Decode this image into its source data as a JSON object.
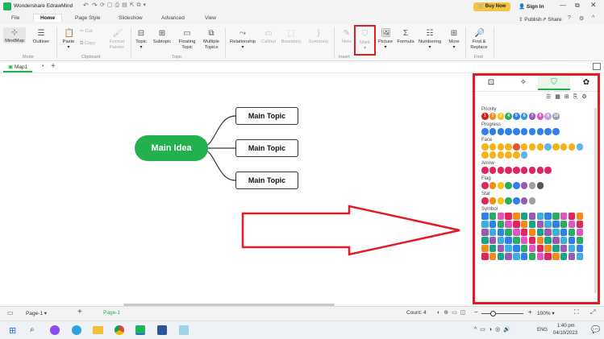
{
  "app": {
    "title": "Wondershare EdrawMind",
    "buy_now": "Buy Now",
    "sign_in": "Sign In",
    "publish": "Publish",
    "share": "Share"
  },
  "menu": {
    "tabs": [
      "File",
      "Home",
      "Page Style",
      "Slideshow",
      "Advanced",
      "View"
    ]
  },
  "ribbon": {
    "buttons": {
      "mindmap": "MindMap",
      "outliner": "Outliner",
      "paste": "Paste",
      "cut": "Cut",
      "copy": "Copy",
      "format_painter": "Format\nPainter",
      "topic": "Topic",
      "subtopic": "Subtopic",
      "floating_topic": "Floating\nTopic",
      "multiple_topics": "Multiple\nTopics",
      "relationship": "Relationship",
      "callout": "Callout",
      "boundary": "Boundary",
      "summary": "Summary",
      "note": "Note",
      "mark": "Mark",
      "picture": "Picture",
      "formula": "Formula",
      "numbering": "Numbering",
      "more": "More",
      "find_replace": "Find &\nReplace"
    },
    "groups": {
      "mode": "Mode",
      "clipboard": "Clipboard",
      "topic": "Topic",
      "insert": "Insert",
      "find": "Find"
    }
  },
  "doc_tab": {
    "label": "Map1"
  },
  "mindmap": {
    "main_idea": "Main Idea",
    "topics": [
      "Main Topic",
      "Main Topic",
      "Main Topic"
    ],
    "main_color": "#22b14c"
  },
  "mark_panel": {
    "sections": {
      "priority": "Priority",
      "progress": "Progress",
      "face": "Face",
      "arrow": "Arrow",
      "flag": "Flag",
      "star": "Star",
      "symbol": "Symbol"
    },
    "priority_labels": [
      "1",
      "2",
      "3",
      "4",
      "5",
      "6",
      "7",
      "8",
      "9",
      "10"
    ],
    "highlight_color": "#e31b23"
  },
  "status": {
    "page_tab": "Page-1",
    "page_tab2": "Page-1",
    "count": "Count: 4",
    "zoom": "100%"
  },
  "taskbar": {
    "time": "1:40 pm",
    "date": "04/10/2023",
    "lang": "ENG"
  }
}
